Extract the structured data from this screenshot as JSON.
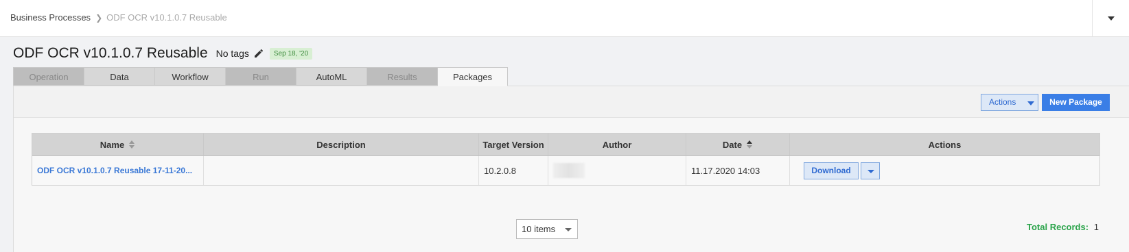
{
  "breadcrumb": {
    "root": "Business Processes",
    "separator": ">",
    "current": "ODF OCR v10.1.0.7 Reusable"
  },
  "header": {
    "title": "ODF OCR v10.1.0.7 Reusable",
    "tags_label": "No tags",
    "date_badge": "Sep 18, '20"
  },
  "tabs": [
    {
      "label": "Operation",
      "state": "disabled"
    },
    {
      "label": "Data",
      "state": "enabled"
    },
    {
      "label": "Workflow",
      "state": "enabled"
    },
    {
      "label": "Run",
      "state": "disabled"
    },
    {
      "label": "AutoML",
      "state": "enabled"
    },
    {
      "label": "Results",
      "state": "disabled"
    },
    {
      "label": "Packages",
      "state": "active"
    }
  ],
  "toolbar": {
    "actions_label": "Actions",
    "new_package_label": "New Package"
  },
  "table": {
    "columns": [
      "Name",
      "Description",
      "Target Version",
      "Author",
      "Date",
      "Actions"
    ],
    "rows": [
      {
        "name": "ODF OCR v10.1.0.7 Reusable 17-11-20...",
        "description": "",
        "target_version": "10.2.0.8",
        "author": "",
        "date": "11.17.2020 14:03",
        "action_label": "Download"
      }
    ]
  },
  "pager": {
    "page_size": "10 items"
  },
  "summary": {
    "total_label": "Total Records:",
    "total_value": "1"
  },
  "colors": {
    "accent": "#3a7ee6",
    "link": "#3a78d6",
    "total_label": "#2aa34a",
    "badge_bg": "#d8efd3"
  }
}
